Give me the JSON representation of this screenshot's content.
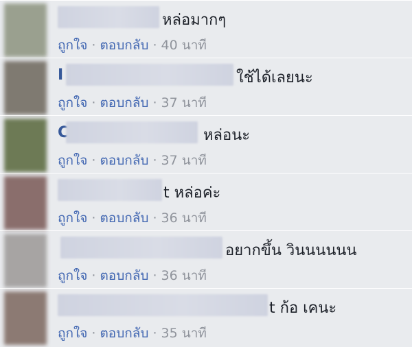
{
  "comments": [
    {
      "text": "หล่อมากๆ",
      "like": "ถูกใจ",
      "reply": "ตอบกลับ",
      "sep": "·",
      "time": "40 นาที",
      "avatar_color": "#9aa08f",
      "lead": ""
    },
    {
      "text": "ใช้ได้เลยนะ",
      "like": "ถูกใจ",
      "reply": "ตอบกลับ",
      "sep": "·",
      "time": "37 นาที",
      "avatar_color": "#7f7a71",
      "lead": "I"
    },
    {
      "text": "หล่อนะ",
      "like": "ถูกใจ",
      "reply": "ตอบกลับ",
      "sep": "·",
      "time": "37 นาที",
      "avatar_color": "#6d7a55",
      "lead": "C"
    },
    {
      "text": "t หล่อค่ะ",
      "like": "ถูกใจ",
      "reply": "ตอบกลับ",
      "sep": "·",
      "time": "36 นาที",
      "avatar_color": "#8a6e6c",
      "lead": ""
    },
    {
      "text": "อยากขึ้น วินนนนนน",
      "like": "ถูกใจ",
      "reply": "ตอบกลับ",
      "sep": "·",
      "time": "36 นาที",
      "avatar_color": "#a7a4a3",
      "lead": ""
    },
    {
      "text": "t ก้อ เคนะ",
      "like": "ถูกใจ",
      "reply": "ตอบกลับ",
      "sep": "·",
      "time": "35 นาที",
      "avatar_color": "#8c7a73",
      "lead": ""
    }
  ]
}
